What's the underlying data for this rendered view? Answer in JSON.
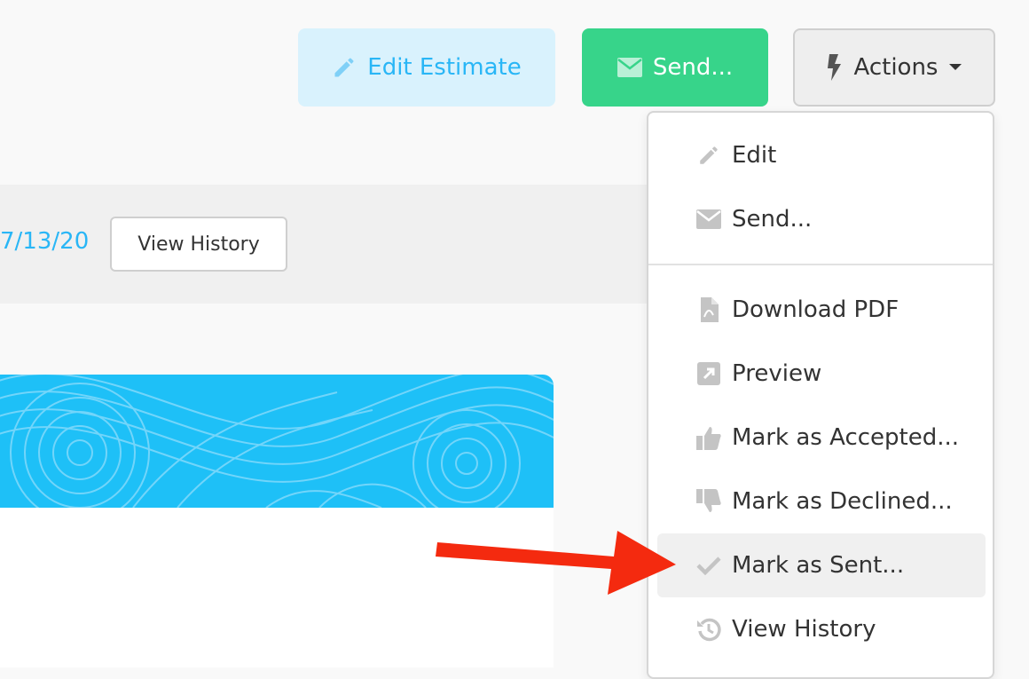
{
  "toolbar": {
    "edit_label": "Edit Estimate",
    "send_label": "Send...",
    "actions_label": "Actions"
  },
  "info": {
    "date": "7/13/20",
    "view_history_label": "View History"
  },
  "dropdown": {
    "items": [
      {
        "label": "Edit",
        "icon": "pencil-icon"
      },
      {
        "label": "Send...",
        "icon": "envelope-icon"
      },
      {
        "label": "Download PDF",
        "icon": "file-pdf-icon"
      },
      {
        "label": "Preview",
        "icon": "external-link-icon"
      },
      {
        "label": "Mark as Accepted...",
        "icon": "thumbs-up-icon"
      },
      {
        "label": "Mark as Declined...",
        "icon": "thumbs-down-icon"
      },
      {
        "label": "Mark as Sent...",
        "icon": "checkmark-icon"
      },
      {
        "label": "View History",
        "icon": "history-icon"
      }
    ]
  },
  "colors": {
    "edit_bg": "#d9f2fd",
    "accent_blue": "#29b6f6",
    "send_green": "#37d48a",
    "banner_blue": "#1ec0f7",
    "arrow_red": "#f42a0f",
    "menu_icon_gray": "#c4c4c4"
  }
}
